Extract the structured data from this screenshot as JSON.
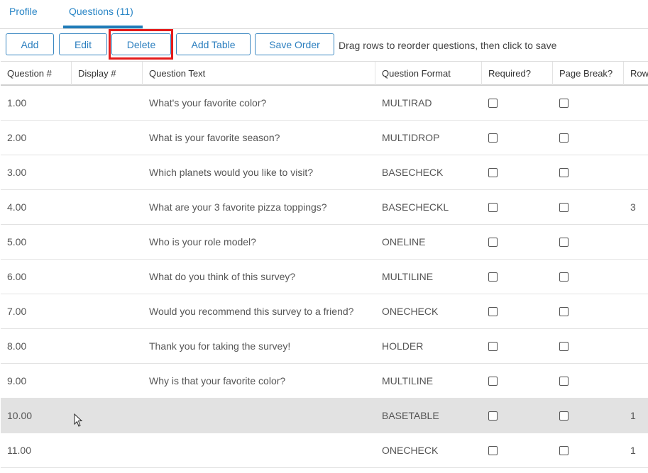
{
  "tabs": [
    {
      "label": "Profile"
    },
    {
      "label": "Questions (11)"
    }
  ],
  "toolbar": {
    "add_label": "Add",
    "edit_label": "Edit",
    "delete_label": "Delete",
    "add_table_label": "Add Table",
    "save_order_label": "Save Order",
    "hint": "Drag rows to reorder questions, then click to save"
  },
  "table": {
    "headers": [
      "Question #",
      "Display #",
      "Question Text",
      "Question Format",
      "Required?",
      "Page Break?",
      "Rows"
    ],
    "rows": [
      {
        "num": "1.00",
        "display": "",
        "text": "What's your favorite color?",
        "format": "MULTIRAD",
        "rows": ""
      },
      {
        "num": "2.00",
        "display": "",
        "text": "What is your favorite season?",
        "format": "MULTIDROP",
        "rows": ""
      },
      {
        "num": "3.00",
        "display": "",
        "text": "Which planets would you like to visit?",
        "format": "BASECHECK",
        "rows": ""
      },
      {
        "num": "4.00",
        "display": "",
        "text": "What are your 3 favorite pizza toppings?",
        "format": "BASECHECKL",
        "rows": "3"
      },
      {
        "num": "5.00",
        "display": "",
        "text": "Who is your role model?",
        "format": "ONELINE",
        "rows": ""
      },
      {
        "num": "6.00",
        "display": "",
        "text": "What do you think of this survey?",
        "format": "MULTILINE",
        "rows": ""
      },
      {
        "num": "7.00",
        "display": "",
        "text": "Would you recommend this survey to a friend?",
        "format": "ONECHECK",
        "rows": ""
      },
      {
        "num": "8.00",
        "display": "",
        "text": "Thank you for taking the survey!",
        "format": "HOLDER",
        "rows": ""
      },
      {
        "num": "9.00",
        "display": "",
        "text": "Why is that your favorite color?",
        "format": "MULTILINE",
        "rows": ""
      },
      {
        "num": "10.00",
        "display": "",
        "text": "",
        "format": "BASETABLE",
        "rows": "1"
      },
      {
        "num": "11.00",
        "display": "",
        "text": "",
        "format": "ONECHECK",
        "rows": "1"
      }
    ]
  }
}
